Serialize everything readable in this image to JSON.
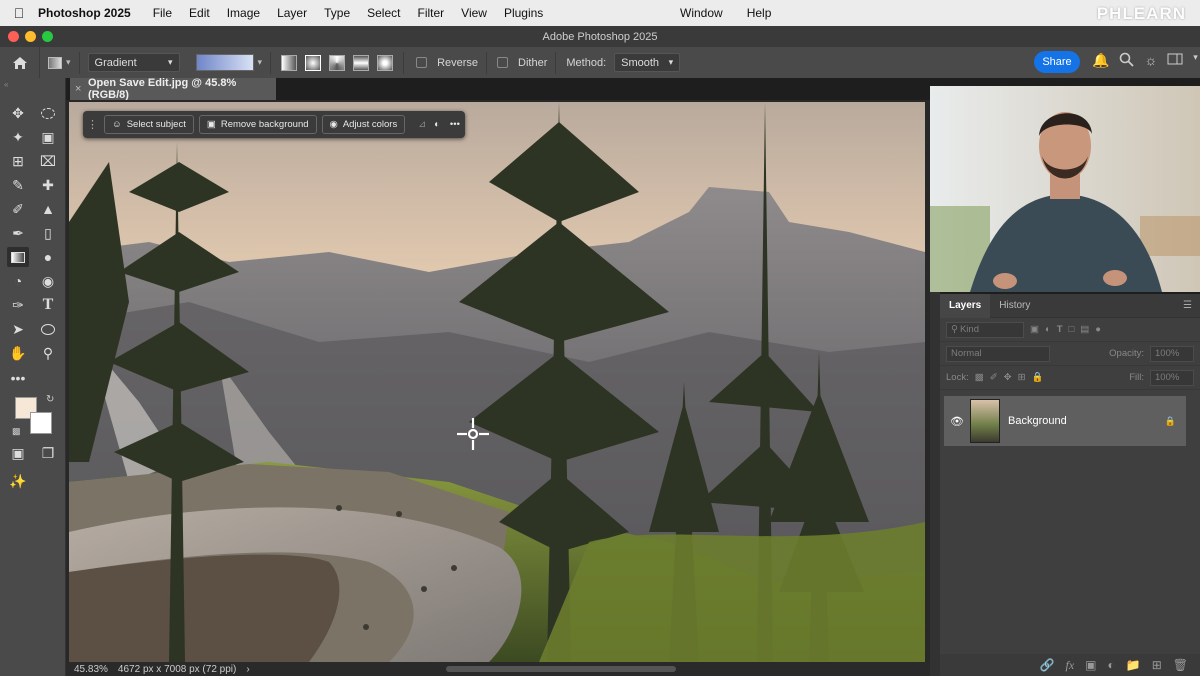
{
  "menubar": {
    "app": "Photoshop 2025",
    "items": [
      "File",
      "Edit",
      "Image",
      "Layer",
      "Type",
      "Select",
      "Filter",
      "View",
      "Plugins"
    ],
    "right_items": [
      "Window",
      "Help"
    ],
    "brand": "PHLEARN"
  },
  "window": {
    "title": "Adobe Photoshop 2025"
  },
  "options": {
    "tool_preset": "Gradient",
    "reverse_label": "Reverse",
    "dither_label": "Dither",
    "method_label": "Method:",
    "method_value": "Smooth",
    "share_label": "Share"
  },
  "document": {
    "tab_title": "Open Save Edit.jpg @ 45.8% (RGB/8)",
    "tab_close": "×",
    "zoom": "45.83%",
    "dimensions": "4672 px x 7008 px (72 ppi)",
    "status_arrow": "›"
  },
  "contextual_taskbar": {
    "select_subject": "Select subject",
    "remove_background": "Remove background",
    "adjust_colors": "Adjust colors",
    "more": "•••"
  },
  "panel": {
    "tabs": [
      "Layers",
      "History"
    ],
    "kind_placeholder": "Kind",
    "blend_mode": "Normal",
    "opacity_label": "Opacity:",
    "opacity_value": "100%",
    "lock_label": "Lock:",
    "fill_label": "Fill:",
    "fill_value": "100%",
    "layer_name": "Background"
  },
  "colors": {
    "accent": "#1473e6",
    "panel_bg": "#3f3f3f",
    "toolbar_bg": "#4a4a4a",
    "foreground": "#f7e7d6",
    "background": "#ffffff"
  }
}
